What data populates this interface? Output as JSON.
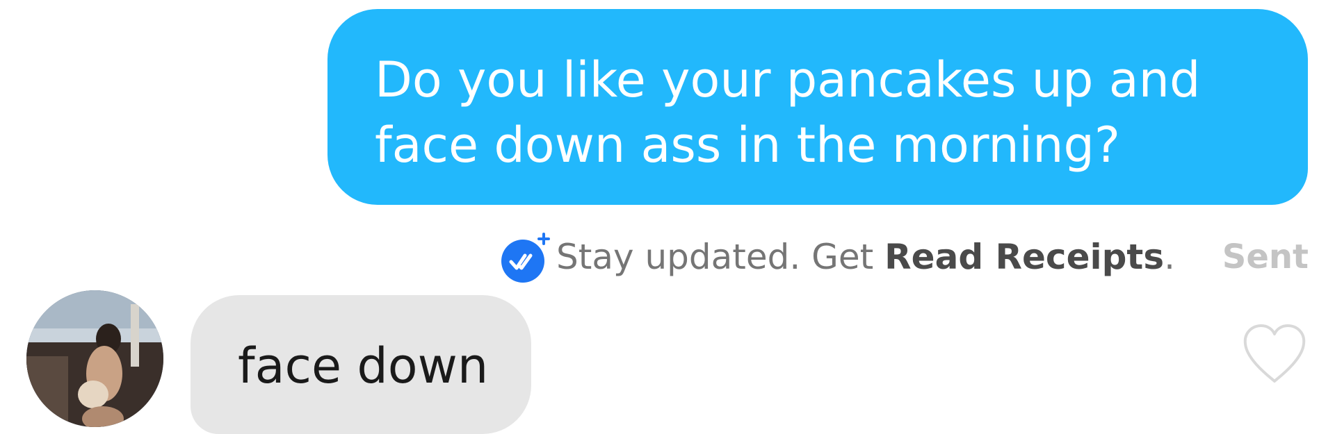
{
  "sent_message": {
    "lines": [
      "Do you like your pancakes up and",
      "face down ass in the morning?"
    ],
    "bubble_color": "#22b8fc",
    "text_color": "#ffffff"
  },
  "read_receipt": {
    "icon": "read-receipt-check-icon",
    "prefix": "Stay updated. Get ",
    "link": "Read Receipts",
    "suffix": ".",
    "accent_color": "#1e76f4"
  },
  "status": {
    "label": "Sent"
  },
  "received_message": {
    "text": "face down",
    "bubble_color": "#e6e6e6"
  },
  "avatar": {
    "icon": "avatar"
  },
  "like": {
    "icon": "heart-outline-icon"
  }
}
